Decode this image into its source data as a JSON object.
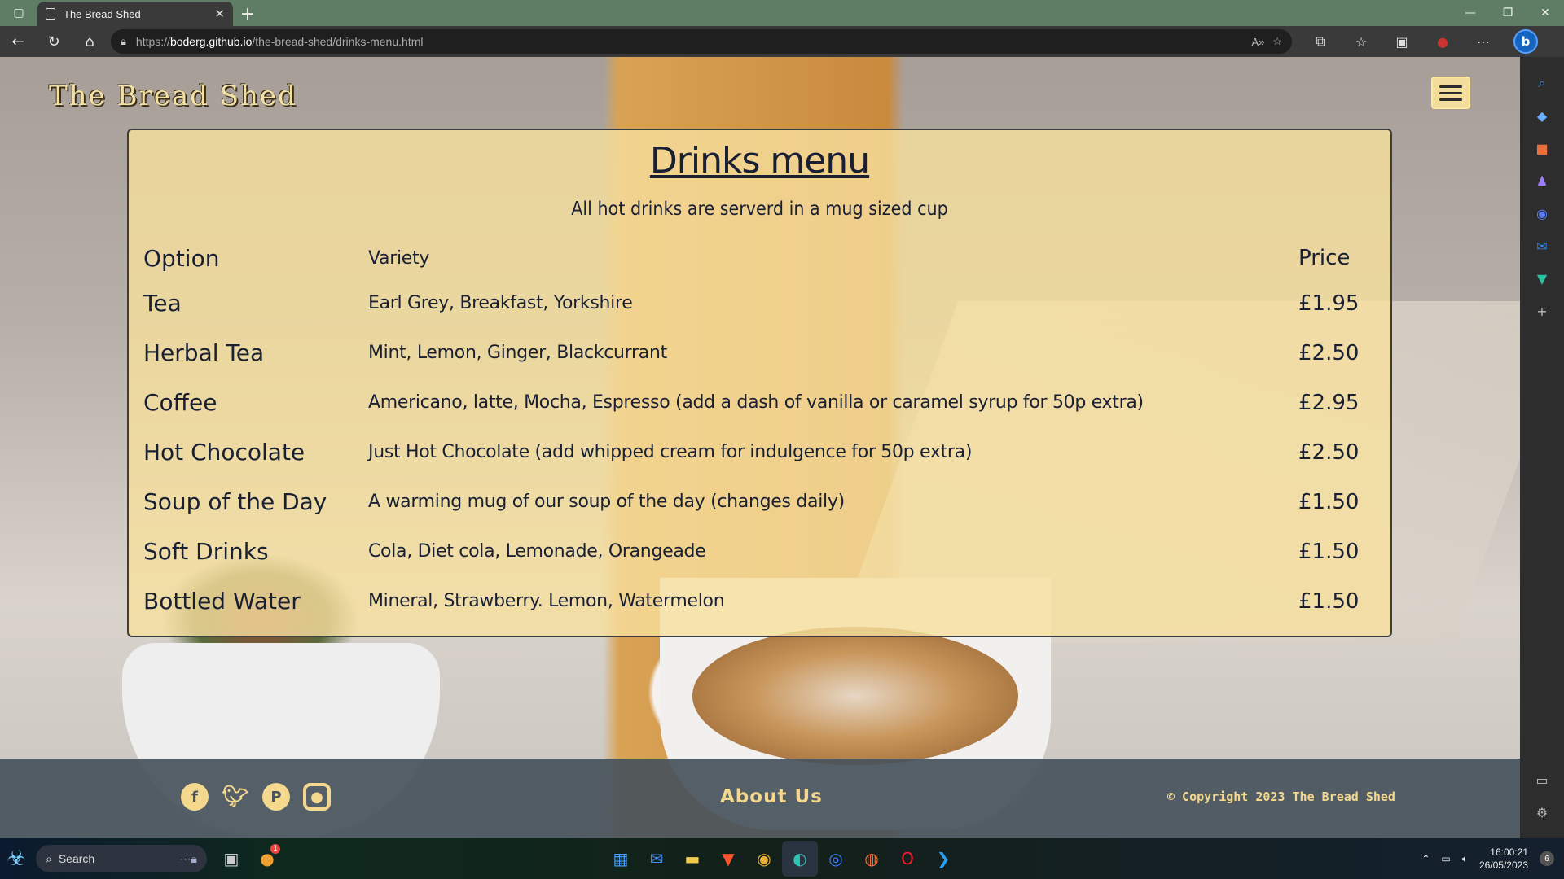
{
  "browser": {
    "tab_title": "The Bread Shed",
    "url_prefix": "https://",
    "url_host": "boderg.github.io",
    "url_path": "/the-bread-shed/drinks-menu.html"
  },
  "site": {
    "logo": "The Bread Shed"
  },
  "menu": {
    "title": "Drinks menu",
    "subtitle": "All hot drinks are serverd in a mug sized cup",
    "headers": {
      "option": "Option",
      "variety": "Variety",
      "price": "Price"
    },
    "rows": [
      {
        "option": "Tea",
        "variety": "Earl Grey, Breakfast, Yorkshire",
        "price": "£1.95"
      },
      {
        "option": "Herbal Tea",
        "variety": "Mint, Lemon, Ginger, Blackcurrant",
        "price": "£2.50"
      },
      {
        "option": "Coffee",
        "variety": "Americano, latte, Mocha, Espresso (add a dash of vanilla or caramel syrup for 50p extra)",
        "price": "£2.95"
      },
      {
        "option": "Hot Chocolate",
        "variety": "Just Hot Chocolate (add whipped cream for indulgence for 50p extra)",
        "price": "£2.50"
      },
      {
        "option": "Soup of the Day",
        "variety": "A warming mug of our soup of the day (changes daily)",
        "price": "£1.50"
      },
      {
        "option": "Soft Drinks",
        "variety": "Cola, Diet cola, Lemonade, Orangeade",
        "price": "£1.50"
      },
      {
        "option": "Bottled Water",
        "variety": "Mineral, Strawberry. Lemon, Watermelon",
        "price": "£1.50"
      }
    ]
  },
  "footer": {
    "about": "About Us",
    "copyright": "© Copyright 2023 The Bread Shed",
    "socials": [
      "facebook-icon",
      "twitter-icon",
      "pinterest-icon",
      "instagram-icon"
    ]
  },
  "taskbar": {
    "search_label": "Search",
    "time": "16:00:21",
    "date": "26/05/2023",
    "notification_count": "6",
    "app_badge": "1"
  },
  "colors": {
    "accent": "#f4d88e",
    "panel": "#f8e09e",
    "footer": "#48525c",
    "text": "#1a2033"
  }
}
